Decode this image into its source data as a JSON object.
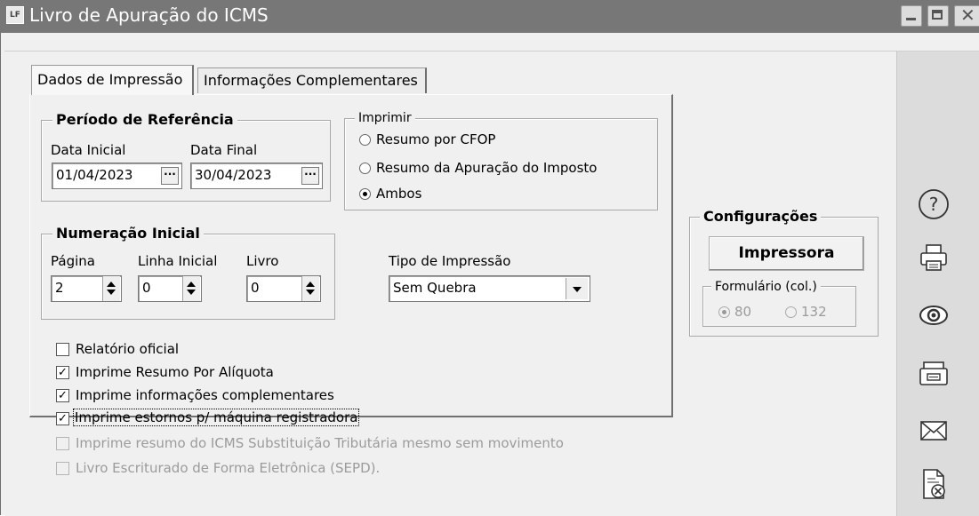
{
  "window": {
    "title": "Livro de Apuração do ICMS",
    "app_icon_label": "LF"
  },
  "tabs": [
    {
      "label": "Dados de Impressão",
      "active": true
    },
    {
      "label": "Informações Complementares",
      "active": false
    }
  ],
  "periodo": {
    "title": "Período de Referência",
    "data_inicial_label": "Data Inicial",
    "data_inicial_value": "01/04/2023",
    "data_final_label": "Data Final",
    "data_final_value": "30/04/2023",
    "dots": "···"
  },
  "imprimir": {
    "title": "Imprimir",
    "options": [
      {
        "label": "Resumo por CFOP",
        "selected": false
      },
      {
        "label": "Resumo da Apuração do Imposto",
        "selected": false
      },
      {
        "label": "Ambos",
        "selected": true
      }
    ]
  },
  "numeracao": {
    "title": "Numeração Inicial",
    "pagina_label": "Página",
    "pagina_value": "2",
    "linha_label": "Linha Inicial",
    "linha_value": "0",
    "livro_label": "Livro",
    "livro_value": "0"
  },
  "tipo_impressao": {
    "label": "Tipo de Impressão",
    "value": "Sem Quebra"
  },
  "checkboxes": [
    {
      "label": "Relatório oficial",
      "checked": false,
      "enabled": true
    },
    {
      "label": "Imprime Resumo Por Alíquota",
      "checked": true,
      "enabled": true
    },
    {
      "label": "Imprime informações complementares",
      "checked": true,
      "enabled": true
    },
    {
      "label": "Imprime estornos p/ máquina registradora",
      "checked": true,
      "enabled": true
    },
    {
      "label": "Imprime resumo do ICMS Substituição Tributária mesmo sem movimento",
      "checked": false,
      "enabled": false
    },
    {
      "label": "Livro Escriturado de Forma Eletrônica (SEPD).",
      "checked": false,
      "enabled": false
    }
  ],
  "configuracoes": {
    "title": "Configurações",
    "impressora_button": "Impressora",
    "formulario_title": "Formulário (col.)",
    "opt_80": "80",
    "opt_132": "132",
    "selected": "80"
  },
  "side_icons": [
    "help-icon",
    "printer-icon",
    "preview-eye-icon",
    "fax-icon",
    "email-envelope-icon",
    "cancel-document-icon"
  ],
  "colors": {
    "titlebar": "#777777",
    "window_bg": "#f0f0f0",
    "sidebar_bg": "#dcdcdc",
    "disabled_text": "#9b9b9b"
  }
}
